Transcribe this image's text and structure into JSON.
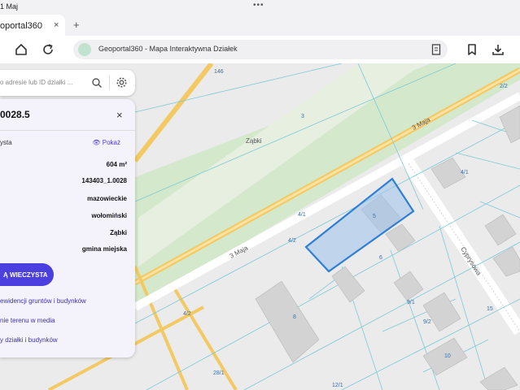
{
  "status": {
    "time": "1 Maj",
    "dots": "•••"
  },
  "tab": {
    "title": "oportal360",
    "close": "×",
    "new": "+"
  },
  "url": {
    "text": "Geoportal360 - Mapa Interaktywna Działek"
  },
  "search": {
    "placeholder": "o adresie lub ID działki ..."
  },
  "panel": {
    "title": "0028.5",
    "close": "×",
    "rows": [
      {
        "label": "ysta",
        "value": ""
      },
      {
        "label": "",
        "value": "604 m²"
      },
      {
        "label": "",
        "value": "143403_1.0028"
      },
      {
        "label": "",
        "value": "mazowieckie"
      },
      {
        "label": "",
        "value": "wołomiński"
      },
      {
        "label": "",
        "value": "Ząbki"
      },
      {
        "label": "",
        "value": "gmina miejska"
      }
    ],
    "show_label": "Pokaż",
    "kw_button": "Ą WIECZYSTA",
    "links": [
      "ewidencji gruntów i budynków",
      "nie terenu w media",
      "y działki i budynków"
    ]
  },
  "map": {
    "labels": [
      {
        "text": "Ząbki"
      },
      {
        "text": "3 Maja"
      },
      {
        "text": "3 Maja"
      },
      {
        "text": "Cyprysowa"
      },
      {
        "text": "146"
      },
      {
        "text": "3"
      },
      {
        "text": "4/1"
      },
      {
        "text": "4/2"
      },
      {
        "text": "4/2"
      },
      {
        "text": "5"
      },
      {
        "text": "6"
      },
      {
        "text": "8"
      },
      {
        "text": "9/1"
      },
      {
        "text": "9/2"
      },
      {
        "text": "10"
      },
      {
        "text": "12/1"
      },
      {
        "text": "15"
      },
      {
        "text": "28/1"
      },
      {
        "text": "2/2"
      },
      {
        "text": "4/1"
      }
    ]
  },
  "colors": {
    "accent": "#4b3fe0",
    "parcel": "#2f7fd8",
    "road": "#f0c55a",
    "green": "#cfe5c6"
  }
}
